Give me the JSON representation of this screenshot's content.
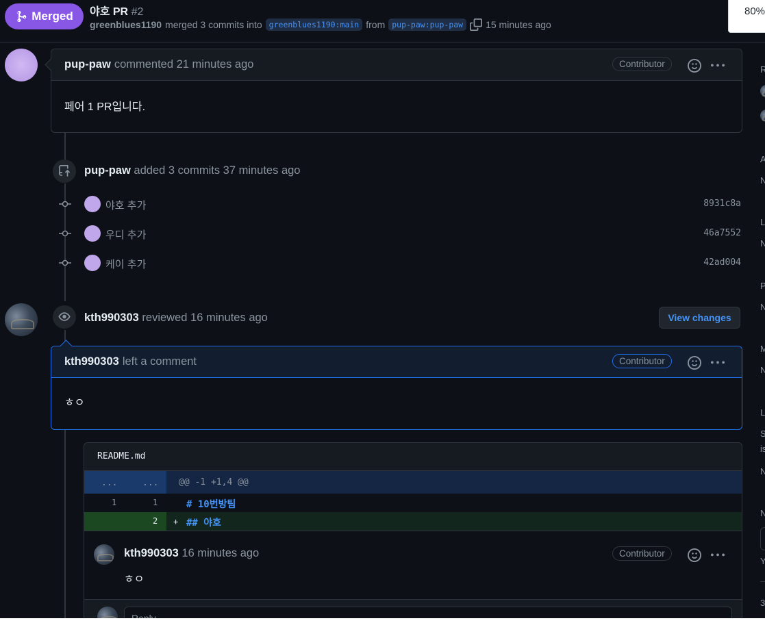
{
  "header": {
    "status_label": "Merged",
    "title": "야호 PR",
    "number": "#2",
    "merge_user": "greenblues1190",
    "merge_text": "merged 3 commits into",
    "base_branch": "greenblues1190:main",
    "from_text": "from",
    "head_branch": "pup-paw:pup-paw",
    "time": "15 minutes ago"
  },
  "zoom": {
    "level": "80%"
  },
  "first_comment": {
    "author": "pup-paw",
    "action": "commented 21 minutes ago",
    "badge": "Contributor",
    "body": "페어 1 PR입니다."
  },
  "commits_event": {
    "author": "pup-paw",
    "action": "added 3 commits 37 minutes ago",
    "commits": [
      {
        "message": "야호 추가",
        "sha": "8931c8a"
      },
      {
        "message": "우디 추가",
        "sha": "46a7552"
      },
      {
        "message": "케이 추가",
        "sha": "42ad004"
      }
    ]
  },
  "review_event": {
    "author": "kth990303",
    "action": "reviewed 16 minutes ago",
    "button_label": "View changes"
  },
  "review_comment": {
    "author": "kth990303",
    "action": "left a comment",
    "badge": "Contributor",
    "body": "ㅎㅇ"
  },
  "diff": {
    "file": "README.md",
    "hunk_left": "...",
    "hunk_right": "...",
    "hunk_header": "@@ -1 +1,4 @@",
    "lines": [
      {
        "old": "1",
        "new": "1",
        "sign": "",
        "text": "# 10번방팀"
      },
      {
        "old": "",
        "new": "2",
        "sign": "+",
        "text": "## 야호"
      }
    ],
    "inline_comment": {
      "author": "kth990303",
      "time": "16 minutes ago",
      "badge": "Contributor",
      "body": "ㅎㅇ"
    },
    "reply_placeholder": "Reply..."
  },
  "sidebar_letters": [
    "R",
    "A",
    "N",
    "L",
    "N",
    "P",
    "N",
    "M",
    "N",
    "L",
    "S",
    "is",
    "N",
    "N",
    "Y",
    "3"
  ],
  "colors": {
    "merged": "#8957e5",
    "accent": "#4493f8",
    "background": "#0d1117"
  }
}
